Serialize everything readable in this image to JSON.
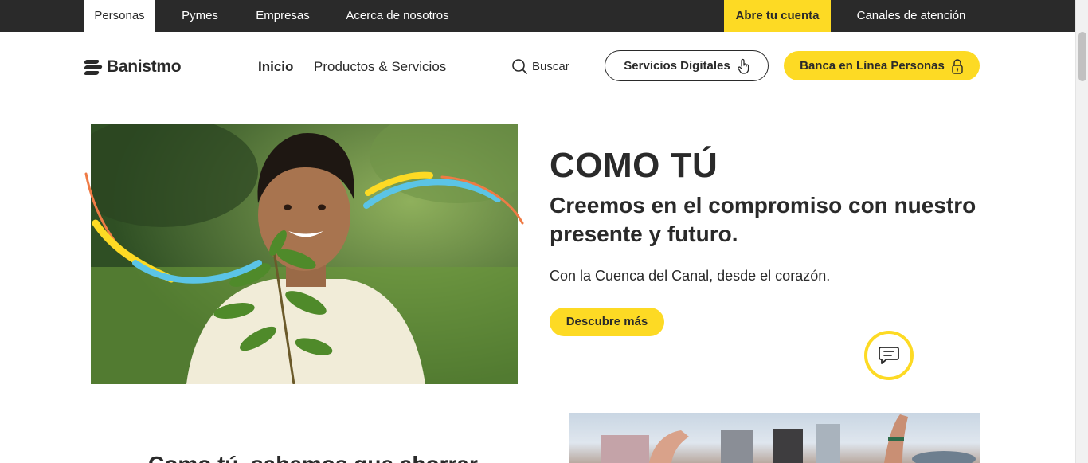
{
  "topbar": {
    "tabs": [
      {
        "label": "Personas",
        "active": true
      },
      {
        "label": "Pymes",
        "active": false
      },
      {
        "label": "Empresas",
        "active": false
      },
      {
        "label": "Acerca de nosotros",
        "active": false
      }
    ],
    "open_account": "Abre tu cuenta",
    "channels": "Canales de atención"
  },
  "header": {
    "logo": "Banistmo",
    "nav": [
      {
        "label": "Inicio",
        "active": true
      },
      {
        "label": "Productos & Servicios",
        "active": false
      }
    ],
    "search_label": "Buscar",
    "digital_services": "Servicios Digitales",
    "online_banking": "Banca en Línea Personas"
  },
  "hero": {
    "title": "COMO TÚ",
    "subtitle": "Creemos en el compromiso con nuestro presente y futuro.",
    "description": "Con la Cuenca del Canal, desde el corazón.",
    "cta": "Descubre más"
  },
  "section2": {
    "title": "Como tú, sabemos que ahorrar"
  },
  "colors": {
    "brand_yellow": "#fdda24",
    "dark": "#2a2a2a",
    "deco_blue": "#5bc4e6",
    "deco_orange": "#ef7b45"
  },
  "icons": [
    "banistmo-logo-icon",
    "search-icon",
    "touch-icon",
    "lock-icon",
    "chat-icon"
  ]
}
